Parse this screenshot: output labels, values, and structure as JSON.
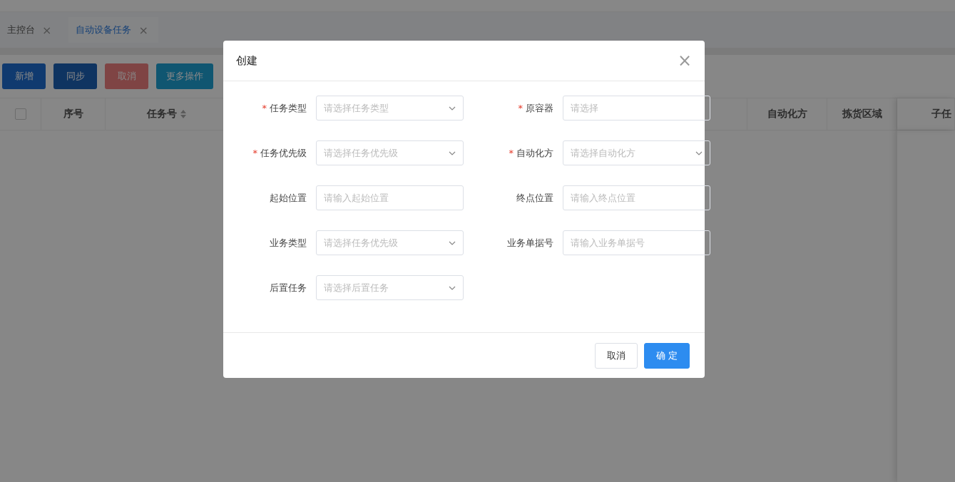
{
  "tabs": [
    {
      "label": "主控台",
      "close": "×",
      "selected": false
    },
    {
      "label": "自动设备任务",
      "close": "×",
      "selected": true
    }
  ],
  "toolbar": [
    {
      "label": "新增",
      "kind": "primary"
    },
    {
      "label": "同步",
      "kind": "secondary"
    },
    {
      "label": "取消",
      "kind": "danger"
    },
    {
      "label": "更多操作",
      "kind": "info"
    }
  ],
  "table": {
    "columns": [
      {
        "kind": "checkbox",
        "checked": false
      },
      {
        "kind": "text",
        "label": "序号"
      },
      {
        "kind": "sort",
        "label": "任务号"
      },
      {
        "kind": "spacer"
      },
      {
        "kind": "text",
        "label": "自动化方"
      },
      {
        "kind": "text",
        "label": "拣货区域"
      },
      {
        "kind": "fixed",
        "label": "子任"
      }
    ]
  },
  "dialog": {
    "title": "创建",
    "close": "×",
    "required_mark": "*",
    "fields": [
      {
        "kind": "select",
        "required": true,
        "label": "任务类型",
        "placeholder": "请选择任务类型"
      },
      {
        "kind": "input",
        "required": true,
        "label": "原容器",
        "placeholder": "请选择"
      },
      {
        "kind": "select",
        "required": true,
        "label": "任务优先级",
        "placeholder": "请选择任务优先级"
      },
      {
        "kind": "select",
        "required": true,
        "label": "自动化方",
        "placeholder": "请选择自动化方"
      },
      {
        "kind": "input",
        "required": false,
        "label": "起始位置",
        "placeholder": "请输入起始位置"
      },
      {
        "kind": "input",
        "required": false,
        "label": "终点位置",
        "placeholder": "请输入终点位置"
      },
      {
        "kind": "select",
        "required": false,
        "label": "业务类型",
        "placeholder": "请选择任务优先级"
      },
      {
        "kind": "input",
        "required": false,
        "label": "业务单据号",
        "placeholder": "请输入业务单据号"
      },
      {
        "kind": "select",
        "required": false,
        "label": "后置任务",
        "placeholder": "请选择后置任务"
      }
    ],
    "buttons": [
      {
        "label": "取消",
        "kind": "default"
      },
      {
        "label": "确 定",
        "kind": "primary"
      }
    ]
  }
}
